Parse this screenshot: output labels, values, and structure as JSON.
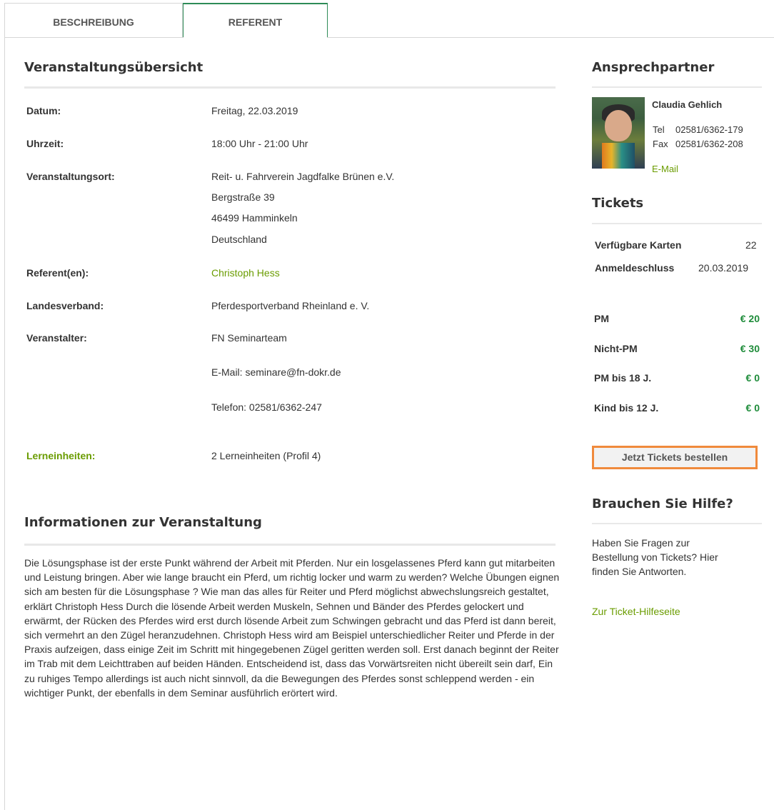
{
  "tabs": {
    "description": "BESCHREIBUNG",
    "speaker": "REFERENT"
  },
  "overview": {
    "title": "Veranstaltungsübersicht",
    "rows": {
      "date": {
        "label": "Datum:",
        "value": "Freitag, 22.03.2019"
      },
      "time": {
        "label": "Uhrzeit:",
        "value": "18:00 Uhr - 21:00 Uhr"
      },
      "venue": {
        "label": "Veranstaltungsort:",
        "lines": [
          "Reit- u. Fahrverein Jagdfalke Brünen e.V.",
          "Bergstraße 39",
          "46499 Hamminkeln",
          "Deutschland"
        ]
      },
      "speakers": {
        "label": "Referent(en):",
        "value": "Christoph Hess"
      },
      "association": {
        "label": "Landesverband:",
        "value": "Pferdesportverband Rheinland e. V."
      },
      "organizer": {
        "label": "Veranstalter:",
        "value": "FN Seminarteam",
        "email": "E-Mail: seminare@fn-dokr.de",
        "phone": "Telefon: 02581/6362-247"
      },
      "learning_units": {
        "label": "Lerneinheiten:",
        "value": "2 Lerneinheiten (Profil 4)"
      }
    }
  },
  "info": {
    "title": "Informationen zur Veranstaltung",
    "text": "Die Lösungsphase ist der erste Punkt während der Arbeit mit Pferden. Nur ein losgelassenes Pferd kann gut mitarbeiten und Leistung bringen. Aber wie lange braucht ein Pferd, um richtig locker und warm zu werden? Welche Übungen eignen sich am besten für die Lösungsphase ? Wie man das alles für Reiter und Pferd möglichst abwechslungsreich gestaltet, erklärt Christoph Hess Durch die lösende Arbeit werden Muskeln, Sehnen und Bänder des Pferdes gelockert und erwärmt, der Rücken des Pferdes wird erst durch lösende Arbeit zum Schwingen gebracht und das Pferd ist dann bereit, sich vermehrt an den Zügel heranzudehnen. Christoph Hess wird am Beispiel unterschiedlicher Reiter und Pferde in der Praxis aufzeigen, dass einige Zeit im Schritt mit hingegebenen Zügel geritten werden soll. Erst danach beginnt der Reiter im Trab mit dem Leichttraben auf beiden Händen. Entscheidend ist, dass das Vorwärtsreiten nicht übereilt sein darf, Ein zu ruhiges Tempo allerdings ist auch nicht sinnvoll, da die Bewegungen des Pferdes sonst schleppend werden - ein wichtiger Punkt, der ebenfalls in dem Seminar ausführlich erörtert wird."
  },
  "contact": {
    "title": "Ansprechpartner",
    "name": "Claudia Gehlich",
    "tel_label": "Tel",
    "tel": "02581/6362-179",
    "fax_label": "Fax",
    "fax": "02581/6362-208",
    "email_link": "E-Mail"
  },
  "tickets": {
    "title": "Tickets",
    "available_label": "Verfügbare Karten",
    "available": "22",
    "deadline_label": "Anmeldeschluss",
    "deadline": "20.03.2019",
    "prices": [
      {
        "label": "PM",
        "price": "€ 20"
      },
      {
        "label": "Nicht-PM",
        "price": "€ 30"
      },
      {
        "label": "PM bis 18 J.",
        "price": "€ 0"
      },
      {
        "label": "Kind bis 12 J.",
        "price": "€ 0"
      }
    ],
    "order_button": "Jetzt Tickets bestellen"
  },
  "help": {
    "title": "Brauchen Sie Hilfe?",
    "text": "Haben Sie Fragen zur Bestellung von Tickets? Hier finden Sie Antworten.",
    "link": "Zur Ticket-Hilfeseite"
  },
  "colors": {
    "accent_green": "#6a9c00",
    "price_green": "#1e8c3a",
    "button_border": "#f08a3c",
    "tab_active_border": "#2e8b57"
  }
}
